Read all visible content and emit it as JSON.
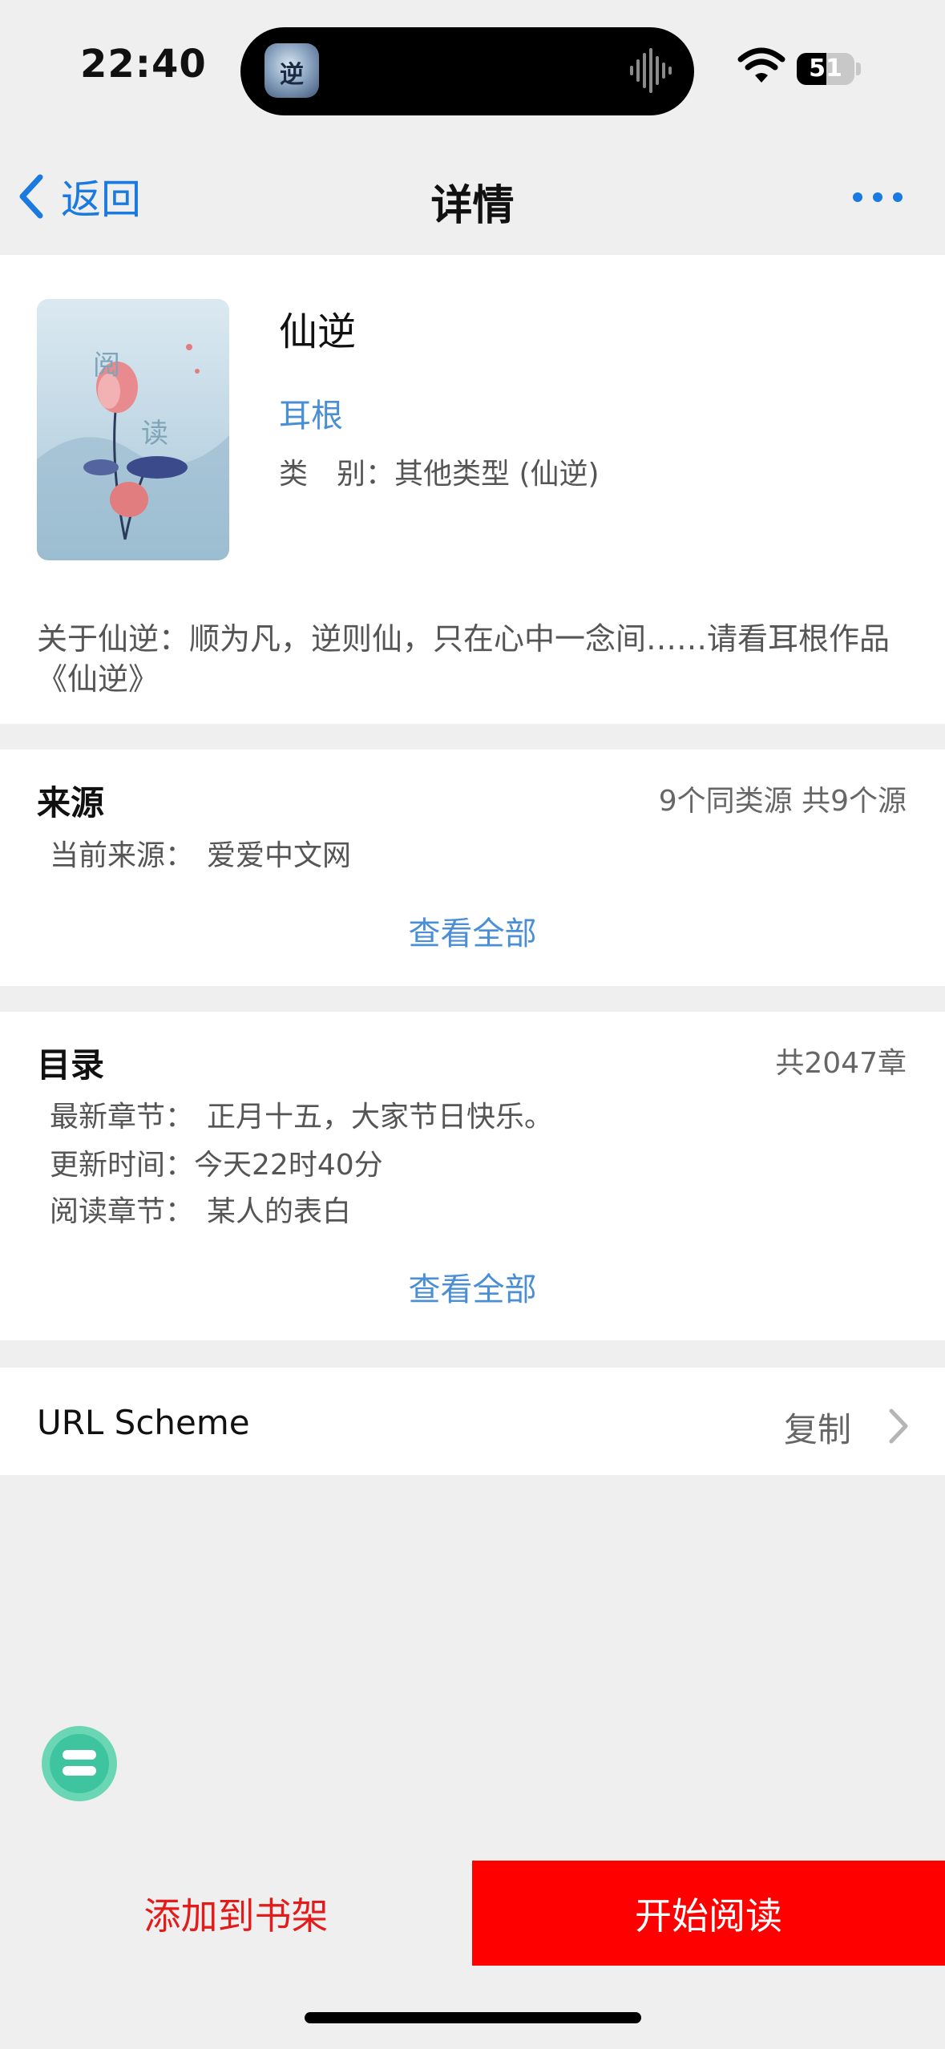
{
  "status_bar": {
    "time": "22:40",
    "battery": "51",
    "icons": [
      "app-icon",
      "audio-wave-icon",
      "wifi-icon",
      "battery-icon"
    ],
    "app_icon_glyph": "逆"
  },
  "nav": {
    "back_label": "返回",
    "title": "详情",
    "more_icon": "more-icon"
  },
  "book": {
    "title": "仙逆",
    "author": "耳根",
    "category_label": "类　别：",
    "category_value": "其他类型 (仙逆)",
    "description": "关于仙逆：顺为凡，逆则仙，只在心中一念间……请看耳根作品《仙逆》",
    "cover_text": [
      "阅",
      "读"
    ]
  },
  "source": {
    "title": "来源",
    "summary": "9个同类源 共9个源",
    "current_label": "当前来源：",
    "current_value": "爱爱中文网",
    "view_all": "查看全部"
  },
  "toc": {
    "title": "目录",
    "summary": "共2047章",
    "latest_label": "最新章节：",
    "latest_value": "正月十五，大家节日快乐。",
    "updated_label": "更新时间：",
    "updated_value": "今天22时40分",
    "reading_label": "阅读章节：",
    "reading_value": "某人的表白",
    "view_all": "查看全部"
  },
  "url_scheme": {
    "label": "URL Scheme",
    "action": "复制"
  },
  "bottom": {
    "add_label": "添加到书架",
    "read_label": "开始阅读"
  },
  "colors": {
    "accent_blue": "#1a7ae0",
    "link_blue": "#4a8fd6",
    "primary_red": "#ff0000",
    "float_green": "#3ec59f"
  }
}
